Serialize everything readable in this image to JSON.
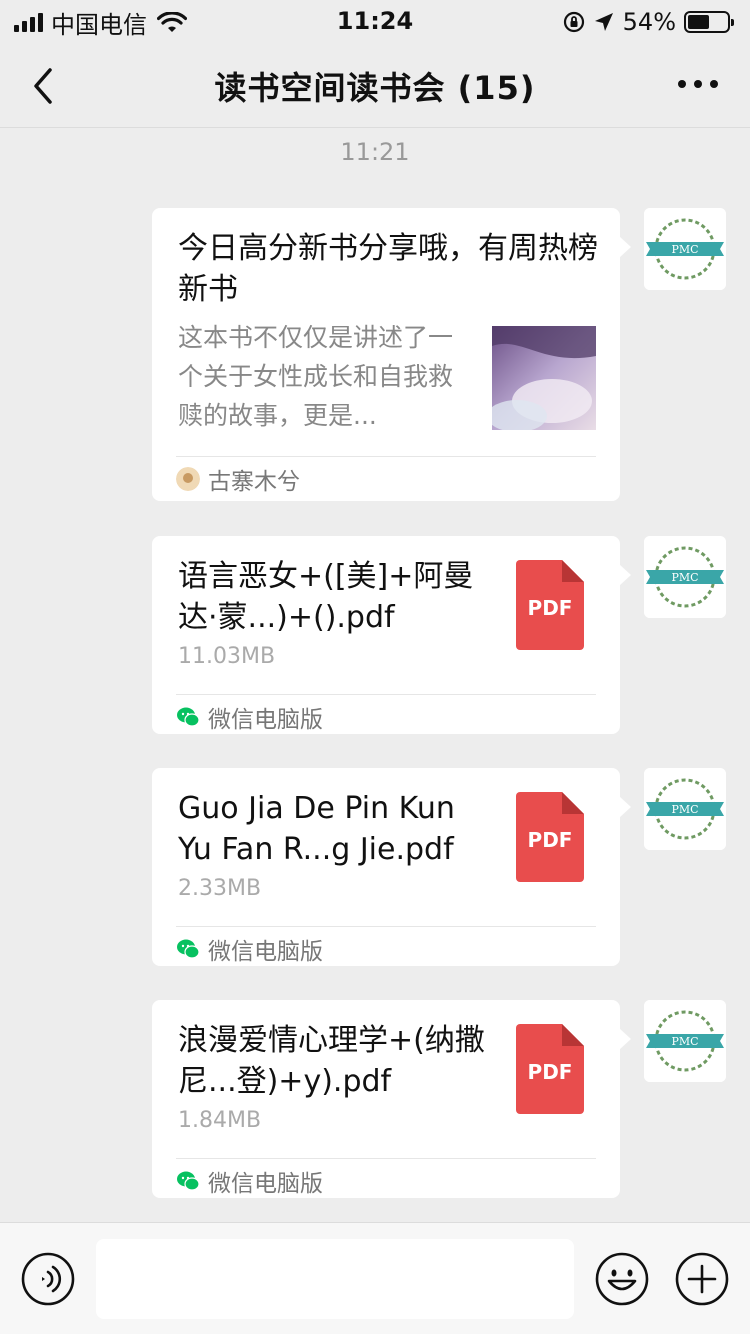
{
  "status_bar": {
    "carrier": "中国电信",
    "time": "11:24",
    "battery": "54%",
    "battery_level": 0.54
  },
  "nav": {
    "title": "读书空间读书会 (15)"
  },
  "chat": {
    "timestamp": "11:21"
  },
  "messages": [
    {
      "type": "link-card",
      "title": "今日高分新书分享哦，有周热榜新书",
      "description": "这本书不仅仅是讲述了一个关于女性成长和自我救赎的故事，更是...",
      "source": "古寨木兮"
    },
    {
      "type": "file",
      "file_name": "语言恶女+([美]+阿曼达·蒙...)+().pdf",
      "file_size": "11.03MB",
      "file_type": "PDF",
      "source": "微信电脑版"
    },
    {
      "type": "file",
      "file_name": "Guo Jia De Pin Kun Yu Fan R...g Jie.pdf",
      "file_size": "2.33MB",
      "file_type": "PDF",
      "source": "微信电脑版"
    },
    {
      "type": "file",
      "file_name": "浪漫爱情心理学+(纳撒尼...登)+y).pdf",
      "file_size": "1.84MB",
      "file_type": "PDF",
      "source": "微信电脑版"
    }
  ],
  "avatar": {
    "text": "PMC"
  },
  "colors": {
    "background": "#ededed",
    "bubble": "#ffffff",
    "pdf_red": "#e84d4d",
    "wechat_green": "#07c160",
    "avatar_teal": "#3aa6a8"
  }
}
